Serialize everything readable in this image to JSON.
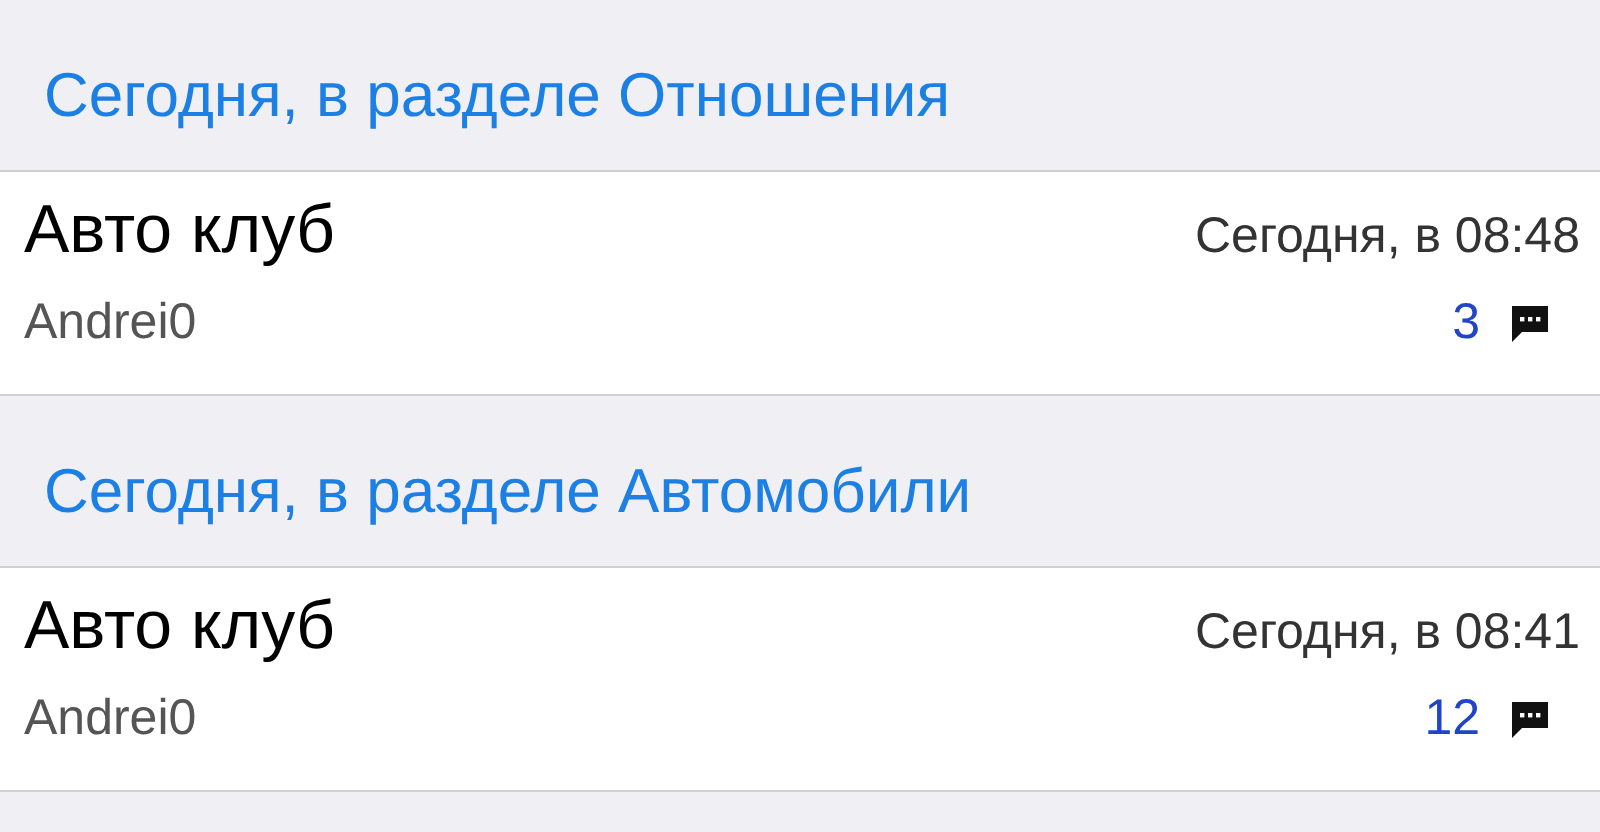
{
  "sections": [
    {
      "header": "Сегодня, в разделе Отношения",
      "topics": [
        {
          "title": "Авто клуб",
          "time": "Сегодня, в 08:48",
          "author": "Andrei0",
          "replies": "3"
        }
      ]
    },
    {
      "header": "Сегодня, в разделе Автомобили",
      "topics": [
        {
          "title": "Авто клуб",
          "time": "Сегодня, в 08:41",
          "author": "Andrei0",
          "replies": "12"
        }
      ]
    }
  ]
}
